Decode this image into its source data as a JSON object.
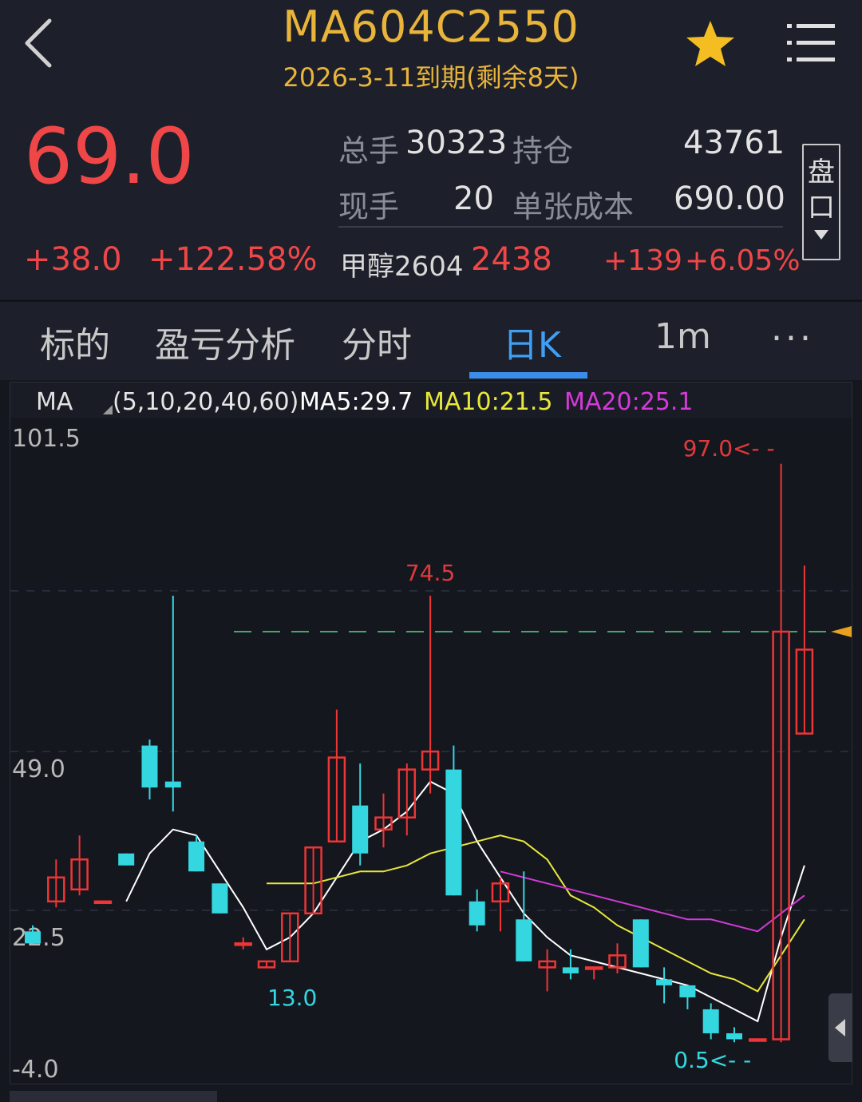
{
  "header": {
    "title": "MA604C2550",
    "subtitle": "2026-3-11到期(剩余8天)"
  },
  "quote": {
    "price": "69.0",
    "change": "+38.0",
    "change_pct": "+122.58%",
    "total_volume_label": "总手",
    "total_volume": "30323",
    "open_interest_label": "持仓",
    "open_interest": "43761",
    "current_volume_label": "现手",
    "current_volume": "20",
    "unit_cost_label": "单张成本",
    "unit_cost": "690.00",
    "underlying_name": "甲醇2604",
    "underlying_price": "2438",
    "underlying_change": "+139",
    "underlying_change_pct": "+6.05%",
    "panel_button": "盘口"
  },
  "tabs": [
    "标的",
    "盈亏分析",
    "分时",
    "日K",
    "1m",
    "..."
  ],
  "active_tab": 3,
  "colors": {
    "up": "#ef3535",
    "down": "#34d7e0",
    "ma5": "#ffffff",
    "ma10": "#e8e83a",
    "ma20": "#d43ad9",
    "accent": "#e8b43a"
  },
  "chart_data": {
    "type": "candlestick",
    "indicator_label": "MA",
    "indicator_params": "(5,10,20,40,60)",
    "ma_labels": [
      "MA5:29.7",
      "MA10:21.5",
      "MA20:25.1"
    ],
    "y_axis_labels": [
      "101.5",
      "49.0",
      "22.5",
      "-4.0"
    ],
    "ylim": [
      -4.0,
      101.5
    ],
    "max_label": "97.0<- -",
    "mid_high_label": "74.5",
    "low_label_1": "13.0",
    "low_label_2": "0.5<- -",
    "reference_line": 69.0,
    "candles": [
      {
        "o": 19,
        "h": 20,
        "l": 17,
        "c": 17
      },
      {
        "o": 24,
        "h": 31,
        "l": 23,
        "c": 28
      },
      {
        "o": 26,
        "h": 35,
        "l": 25,
        "c": 31
      },
      {
        "o": 24,
        "h": 24,
        "l": 24,
        "c": 24
      },
      {
        "o": 32,
        "h": 32,
        "l": 30,
        "c": 30
      },
      {
        "o": 50,
        "h": 51,
        "l": 41,
        "c": 43
      },
      {
        "o": 44,
        "h": 75,
        "l": 39,
        "c": 43
      },
      {
        "o": 34,
        "h": 35,
        "l": 29,
        "c": 29
      },
      {
        "o": 27,
        "h": 27,
        "l": 22,
        "c": 22
      },
      {
        "o": 17,
        "h": 18,
        "l": 16,
        "c": 17
      },
      {
        "o": 13,
        "h": 14,
        "l": 13,
        "c": 14
      },
      {
        "o": 14,
        "h": 22,
        "l": 14,
        "c": 22
      },
      {
        "o": 22,
        "h": 33,
        "l": 22,
        "c": 33
      },
      {
        "o": 34,
        "h": 56,
        "l": 34,
        "c": 48
      },
      {
        "o": 40,
        "h": 47,
        "l": 30,
        "c": 32
      },
      {
        "o": 36,
        "h": 42,
        "l": 33,
        "c": 38
      },
      {
        "o": 38,
        "h": 47,
        "l": 35,
        "c": 46
      },
      {
        "o": 46,
        "h": 75,
        "l": 42,
        "c": 49
      },
      {
        "o": 46,
        "h": 50,
        "l": 25,
        "c": 25
      },
      {
        "o": 24,
        "h": 26,
        "l": 19,
        "c": 20
      },
      {
        "o": 24,
        "h": 28,
        "l": 19,
        "c": 27
      },
      {
        "o": 21,
        "h": 29,
        "l": 14,
        "c": 14
      },
      {
        "o": 13,
        "h": 16,
        "l": 9,
        "c": 14
      },
      {
        "o": 13,
        "h": 16,
        "l": 11,
        "c": 12
      },
      {
        "o": 13,
        "h": 13,
        "l": 11,
        "c": 13
      },
      {
        "o": 13,
        "h": 17,
        "l": 12,
        "c": 15
      },
      {
        "o": 21,
        "h": 21,
        "l": 13,
        "c": 13
      },
      {
        "o": 11,
        "h": 13,
        "l": 7,
        "c": 10
      },
      {
        "o": 10,
        "h": 10,
        "l": 6,
        "c": 8
      },
      {
        "o": 6,
        "h": 7,
        "l": 1,
        "c": 2
      },
      {
        "o": 2,
        "h": 3,
        "l": 0.5,
        "c": 1
      },
      {
        "o": 1,
        "h": 1,
        "l": 1,
        "c": 1
      },
      {
        "o": 1,
        "h": 97,
        "l": 0.5,
        "c": 69
      },
      {
        "o": 52,
        "h": 80,
        "l": 52,
        "c": 66
      }
    ],
    "series": [
      {
        "name": "MA5",
        "values": [
          null,
          null,
          null,
          null,
          24,
          32,
          36,
          35,
          29,
          23,
          16,
          18,
          22,
          28,
          34,
          36,
          39,
          44,
          42,
          34,
          28,
          22,
          18,
          15,
          14,
          13,
          12,
          11,
          10,
          8,
          6,
          4,
          18,
          30
        ]
      },
      {
        "name": "MA10",
        "values": [
          null,
          null,
          null,
          null,
          null,
          null,
          null,
          null,
          null,
          null,
          27,
          27,
          27,
          28,
          29,
          29,
          30,
          32,
          33,
          34,
          35,
          34,
          31,
          25,
          23,
          20,
          18,
          16,
          14,
          12,
          11,
          9,
          15,
          21
        ]
      },
      {
        "name": "MA20",
        "values": [
          null,
          null,
          null,
          null,
          null,
          null,
          null,
          null,
          null,
          null,
          null,
          null,
          null,
          null,
          null,
          null,
          null,
          null,
          null,
          null,
          29,
          28,
          27,
          26,
          25,
          24,
          23,
          22,
          21,
          21,
          20,
          19,
          22,
          25
        ]
      }
    ]
  }
}
